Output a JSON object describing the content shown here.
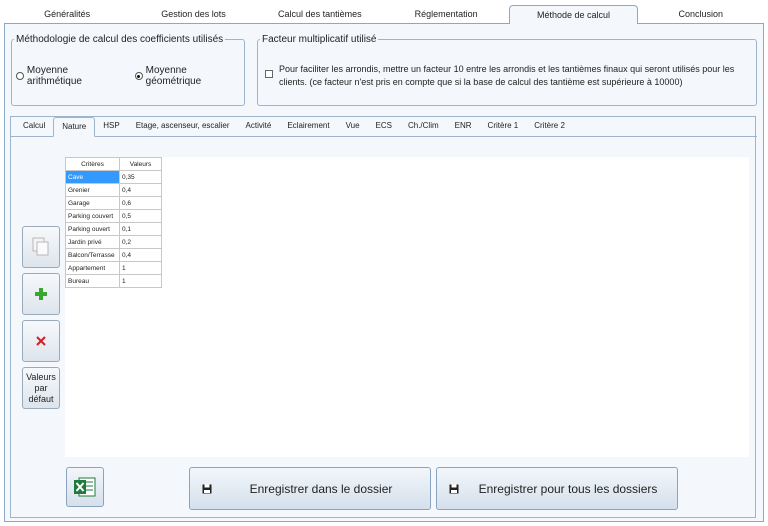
{
  "main_tabs": [
    {
      "label": "Généralités"
    },
    {
      "label": "Gestion des lots"
    },
    {
      "label": "Calcul des tantièmes"
    },
    {
      "label": "Réglementation"
    },
    {
      "label": "Méthode de calcul"
    },
    {
      "label": "Conclusion"
    }
  ],
  "methodology": {
    "legend": "Méthodologie de calcul des coefficients utilisés",
    "options": [
      {
        "label": "Moyenne arithmétique",
        "selected": false
      },
      {
        "label": "Moyenne géométrique",
        "selected": true
      }
    ]
  },
  "factor": {
    "legend": "Facteur multiplicatif utilisé",
    "checkbox_label": "Pour faciliter les arrondis, mettre un facteur 10 entre les arrondis et les tantièmes finaux qui seront utilisés pour les clients. (ce facteur n'est pris en compte que si la base de calcul des tantième est supérieure à 10000)",
    "checked": false
  },
  "sub_tabs": [
    {
      "label": "Calcul"
    },
    {
      "label": "Nature"
    },
    {
      "label": "HSP"
    },
    {
      "label": "Etage, ascenseur, escalier"
    },
    {
      "label": "Activité"
    },
    {
      "label": "Eclairement"
    },
    {
      "label": "Vue"
    },
    {
      "label": "ECS"
    },
    {
      "label": "Ch./Clim"
    },
    {
      "label": "ENR"
    },
    {
      "label": "Critère 1"
    },
    {
      "label": "Critère 2"
    }
  ],
  "grid": {
    "headers": [
      "Critères",
      "Valeurs"
    ],
    "rows": [
      {
        "critere": "Cave",
        "valeur": "0,35"
      },
      {
        "critere": "Grenier",
        "valeur": "0,4"
      },
      {
        "critere": "Garage",
        "valeur": "0,6"
      },
      {
        "critere": "Parking couvert",
        "valeur": "0,5"
      },
      {
        "critere": "Parking ouvert",
        "valeur": "0,1"
      },
      {
        "critere": "Jardin privé",
        "valeur": "0,2"
      },
      {
        "critere": "Balcon/Terrasse",
        "valeur": "0,4"
      },
      {
        "critere": "Appartement",
        "valeur": "1"
      },
      {
        "critere": "Bureau",
        "valeur": "1"
      }
    ]
  },
  "side_buttons": {
    "default_values_label_1": "Valeurs",
    "default_values_label_2": "par",
    "default_values_label_3": "défaut"
  },
  "bottom_buttons": {
    "save_folder": "Enregistrer dans le dossier",
    "save_all": "Enregistrer pour tous les dossiers"
  },
  "colors": {
    "accent": "#3399ff",
    "add_icon": "#3aa52f",
    "delete_icon": "#d42020",
    "excel_green": "#1f7a3c"
  }
}
